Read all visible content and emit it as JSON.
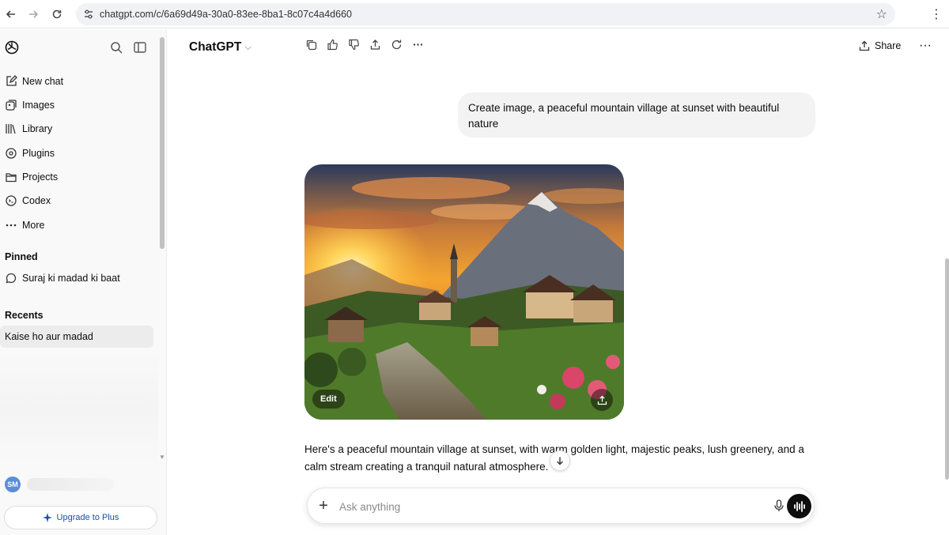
{
  "browser": {
    "url": "chatgpt.com/c/6a69d49a-30a0-83ee-8ba1-8c07c4a4d660"
  },
  "sidebar": {
    "items": [
      {
        "label": "New chat",
        "icon": "new-chat-icon"
      },
      {
        "label": "Images",
        "icon": "images-icon"
      },
      {
        "label": "Library",
        "icon": "library-icon"
      },
      {
        "label": "Plugins",
        "icon": "plugins-icon"
      },
      {
        "label": "Projects",
        "icon": "folder-icon"
      },
      {
        "label": "Codex",
        "icon": "codex-icon"
      },
      {
        "label": "More",
        "icon": "more-icon"
      }
    ],
    "pinned_heading": "Pinned",
    "pinned": [
      {
        "label": "Suraj ki madad ki baat",
        "icon": "chat-bubble-icon"
      }
    ],
    "recents_heading": "Recents",
    "recents": [
      {
        "label": "Kaise ho aur madad"
      }
    ],
    "user_initials": "SM",
    "upgrade_label": "Upgrade to Plus"
  },
  "header": {
    "model": "ChatGPT",
    "share_label": "Share"
  },
  "conversation": {
    "user_message": "Create image, a peaceful mountain village at sunset with beautiful nature",
    "image_edit_label": "Edit",
    "reply": "Here's a peaceful mountain village at sunset, with warm golden light, majestic peaks, lush greenery, and a calm stream creating a tranquil natural atmosphere."
  },
  "composer": {
    "placeholder": "Ask anything"
  },
  "colors": {
    "accent": "#1a4fa0",
    "sidebar_bg": "#f9f9f9",
    "bubble_bg": "#f3f3f3"
  }
}
